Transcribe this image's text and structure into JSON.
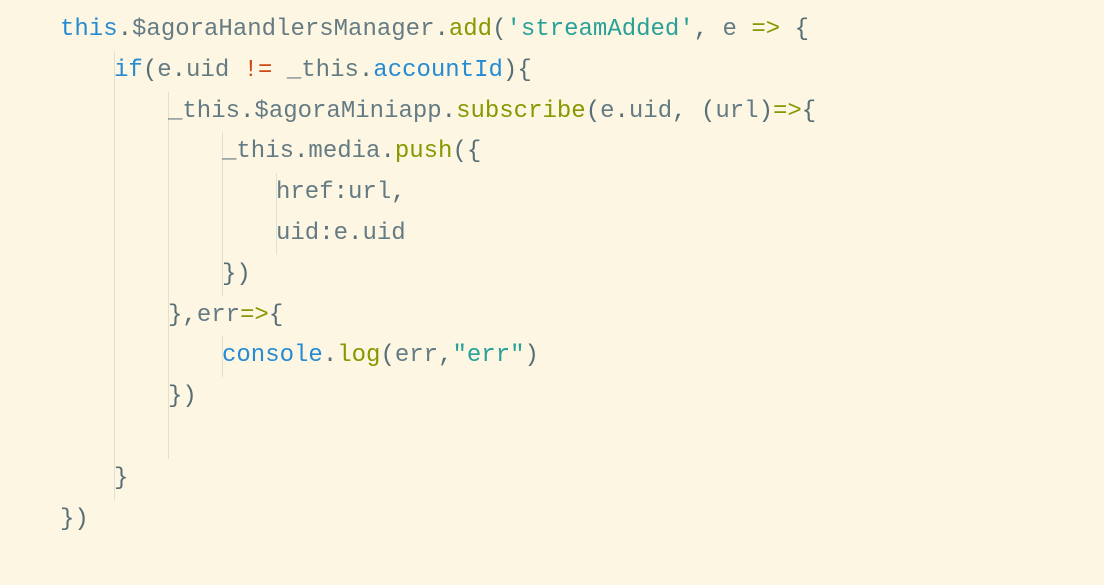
{
  "code": {
    "lines": [
      {
        "indent": 0,
        "guides": [],
        "tokens": [
          {
            "t": "keyword",
            "v": "this"
          },
          {
            "t": "punct",
            "v": "."
          },
          {
            "t": "property",
            "v": "$agoraHandlersManager"
          },
          {
            "t": "punct",
            "v": "."
          },
          {
            "t": "method",
            "v": "add"
          },
          {
            "t": "punct",
            "v": "("
          },
          {
            "t": "string",
            "v": "'streamAdded'"
          },
          {
            "t": "punct",
            "v": ", "
          },
          {
            "t": "param",
            "v": "e"
          },
          {
            "t": "punct",
            "v": " "
          },
          {
            "t": "operator",
            "v": "=>"
          },
          {
            "t": "punct",
            "v": " {"
          }
        ]
      },
      {
        "indent": 1,
        "guides": [
          1
        ],
        "tokens": [
          {
            "t": "keyword",
            "v": "if"
          },
          {
            "t": "punct",
            "v": "("
          },
          {
            "t": "param",
            "v": "e"
          },
          {
            "t": "punct",
            "v": "."
          },
          {
            "t": "property",
            "v": "uid"
          },
          {
            "t": "punct",
            "v": " "
          },
          {
            "t": "notequal",
            "v": "!="
          },
          {
            "t": "punct",
            "v": " "
          },
          {
            "t": "param",
            "v": "_this"
          },
          {
            "t": "punct",
            "v": "."
          },
          {
            "t": "accountProp",
            "v": "accountId"
          },
          {
            "t": "punct",
            "v": "){"
          }
        ]
      },
      {
        "indent": 2,
        "guides": [
          1,
          2
        ],
        "tokens": [
          {
            "t": "param",
            "v": "_this"
          },
          {
            "t": "punct",
            "v": "."
          },
          {
            "t": "property",
            "v": "$agoraMiniapp"
          },
          {
            "t": "punct",
            "v": "."
          },
          {
            "t": "method",
            "v": "subscribe"
          },
          {
            "t": "punct",
            "v": "("
          },
          {
            "t": "param",
            "v": "e"
          },
          {
            "t": "punct",
            "v": "."
          },
          {
            "t": "property",
            "v": "uid"
          },
          {
            "t": "punct",
            "v": ", ("
          },
          {
            "t": "param",
            "v": "url"
          },
          {
            "t": "punct",
            "v": ")"
          },
          {
            "t": "operator",
            "v": "=>"
          },
          {
            "t": "punct",
            "v": "{"
          }
        ]
      },
      {
        "indent": 3,
        "guides": [
          1,
          2,
          3
        ],
        "tokens": [
          {
            "t": "param",
            "v": "_this"
          },
          {
            "t": "punct",
            "v": "."
          },
          {
            "t": "property",
            "v": "media"
          },
          {
            "t": "punct",
            "v": "."
          },
          {
            "t": "method",
            "v": "push"
          },
          {
            "t": "punct",
            "v": "({"
          }
        ]
      },
      {
        "indent": 4,
        "guides": [
          1,
          2,
          3,
          4
        ],
        "tokens": [
          {
            "t": "property",
            "v": "href"
          },
          {
            "t": "punct",
            "v": ":"
          },
          {
            "t": "param",
            "v": "url"
          },
          {
            "t": "punct",
            "v": ","
          }
        ]
      },
      {
        "indent": 4,
        "guides": [
          1,
          2,
          3,
          4
        ],
        "tokens": [
          {
            "t": "property",
            "v": "uid"
          },
          {
            "t": "punct",
            "v": ":"
          },
          {
            "t": "param",
            "v": "e"
          },
          {
            "t": "punct",
            "v": "."
          },
          {
            "t": "property",
            "v": "uid"
          }
        ]
      },
      {
        "indent": 3,
        "guides": [
          1,
          2,
          3
        ],
        "tokens": [
          {
            "t": "punct",
            "v": "})"
          }
        ]
      },
      {
        "indent": 2,
        "guides": [
          1,
          2
        ],
        "tokens": [
          {
            "t": "punct",
            "v": "},"
          },
          {
            "t": "param",
            "v": "err"
          },
          {
            "t": "operator",
            "v": "=>"
          },
          {
            "t": "punct",
            "v": "{"
          }
        ]
      },
      {
        "indent": 3,
        "guides": [
          1,
          2,
          3
        ],
        "tokens": [
          {
            "t": "console",
            "v": "console"
          },
          {
            "t": "punct",
            "v": "."
          },
          {
            "t": "method",
            "v": "log"
          },
          {
            "t": "punct",
            "v": "("
          },
          {
            "t": "param",
            "v": "err"
          },
          {
            "t": "punct",
            "v": ","
          },
          {
            "t": "string",
            "v": "\"err\""
          },
          {
            "t": "punct",
            "v": ")"
          }
        ]
      },
      {
        "indent": 2,
        "guides": [
          1,
          2
        ],
        "tokens": [
          {
            "t": "punct",
            "v": "})"
          }
        ]
      },
      {
        "indent": 0,
        "guides": [
          1,
          2
        ],
        "tokens": [
          {
            "t": "punct",
            "v": ""
          }
        ]
      },
      {
        "indent": 1,
        "guides": [
          1
        ],
        "tokens": [
          {
            "t": "punct",
            "v": "}"
          }
        ]
      },
      {
        "indent": 0,
        "guides": [],
        "tokens": [
          {
            "t": "punct",
            "v": "})"
          }
        ]
      }
    ],
    "indentSize": 4,
    "indentPx": 54
  }
}
